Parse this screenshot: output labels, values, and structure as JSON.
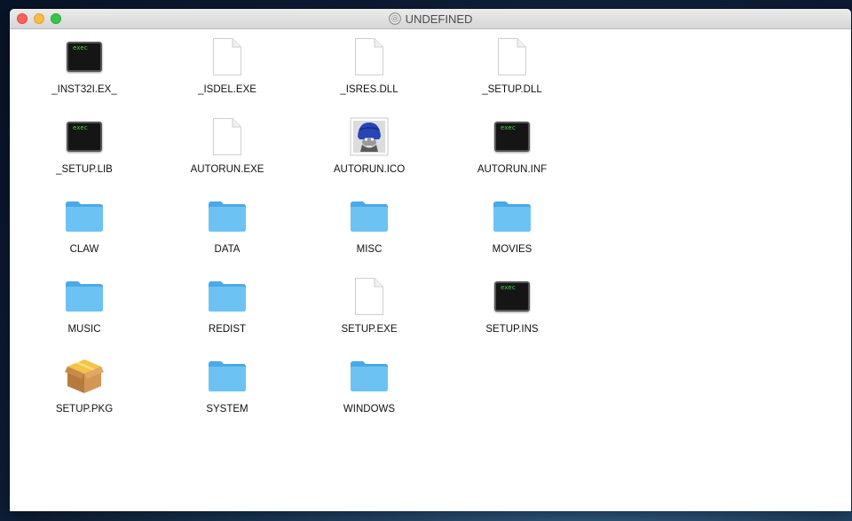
{
  "window": {
    "title": "UNDEFINED",
    "title_icon": "disc-icon"
  },
  "files": [
    {
      "name": "_INST32I.EX_",
      "icon": "exec-icon",
      "icon_text": "exec"
    },
    {
      "name": "_ISDEL.EXE",
      "icon": "document-icon"
    },
    {
      "name": "_ISRES.DLL",
      "icon": "document-icon"
    },
    {
      "name": "_SETUP.DLL",
      "icon": "document-icon"
    },
    {
      "name": "_SETUP.LIB",
      "icon": "exec-icon",
      "icon_text": "exec"
    },
    {
      "name": "AUTORUN.EXE",
      "icon": "document-icon"
    },
    {
      "name": "AUTORUN.ICO",
      "icon": "pirate-image-icon"
    },
    {
      "name": "AUTORUN.INF",
      "icon": "exec-icon",
      "icon_text": "exec"
    },
    {
      "name": "CLAW",
      "icon": "folder-icon"
    },
    {
      "name": "DATA",
      "icon": "folder-icon"
    },
    {
      "name": "MISC",
      "icon": "folder-icon"
    },
    {
      "name": "MOVIES",
      "icon": "folder-icon"
    },
    {
      "name": "MUSIC",
      "icon": "folder-icon"
    },
    {
      "name": "REDIST",
      "icon": "folder-icon"
    },
    {
      "name": "SETUP.EXE",
      "icon": "document-icon"
    },
    {
      "name": "SETUP.INS",
      "icon": "exec-icon",
      "icon_text": "exec"
    },
    {
      "name": "SETUP.PKG",
      "icon": "package-icon"
    },
    {
      "name": "SYSTEM",
      "icon": "folder-icon"
    },
    {
      "name": "WINDOWS",
      "icon": "folder-icon"
    }
  ],
  "colors": {
    "folder": "#5ab8f0",
    "exec_text": "#3cdd3c"
  }
}
